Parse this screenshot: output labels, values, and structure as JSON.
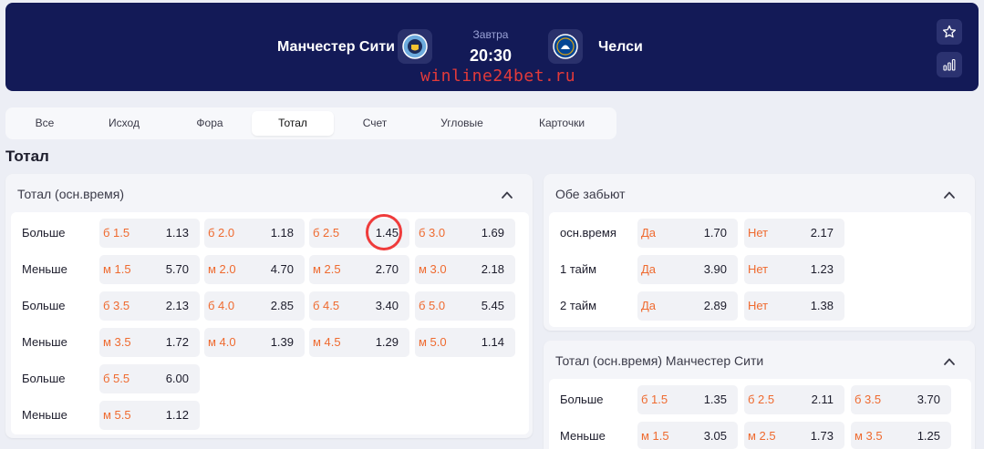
{
  "match": {
    "home_team": "Манчестер Сити",
    "away_team": "Челси",
    "day": "Завтра",
    "time": "20:30",
    "watermark": "winline24bet.ru",
    "home_crest_icon": "man-city-crest-icon",
    "away_crest_icon": "chelsea-crest-icon"
  },
  "tabs": [
    {
      "label": "Все"
    },
    {
      "label": "Исход"
    },
    {
      "label": "Фора"
    },
    {
      "label": "Тотал",
      "active": true
    },
    {
      "label": "Счет"
    },
    {
      "label": "Угловые"
    },
    {
      "label": "Карточки"
    }
  ],
  "section_title": "Тотал",
  "total_panel": {
    "title": "Тотал (осн.время)",
    "rows": [
      {
        "label": "Больше",
        "cells": [
          {
            "k": "б 1.5",
            "o": "1.13"
          },
          {
            "k": "б 2.0",
            "o": "1.18"
          },
          {
            "k": "б 2.5",
            "o": "1.45"
          },
          {
            "k": "б 3.0",
            "o": "1.69"
          }
        ]
      },
      {
        "label": "Меньше",
        "cells": [
          {
            "k": "м 1.5",
            "o": "5.70"
          },
          {
            "k": "м 2.0",
            "o": "4.70"
          },
          {
            "k": "м 2.5",
            "o": "2.70"
          },
          {
            "k": "м 3.0",
            "o": "2.18"
          }
        ]
      },
      {
        "label": "Больше",
        "cells": [
          {
            "k": "б 3.5",
            "o": "2.13"
          },
          {
            "k": "б 4.0",
            "o": "2.85"
          },
          {
            "k": "б 4.5",
            "o": "3.40"
          },
          {
            "k": "б 5.0",
            "o": "5.45"
          }
        ]
      },
      {
        "label": "Меньше",
        "cells": [
          {
            "k": "м 3.5",
            "o": "1.72"
          },
          {
            "k": "м 4.0",
            "o": "1.39"
          },
          {
            "k": "м 4.5",
            "o": "1.29"
          },
          {
            "k": "м 5.0",
            "o": "1.14"
          }
        ]
      },
      {
        "label": "Больше",
        "cells": [
          {
            "k": "б 5.5",
            "o": "6.00"
          }
        ]
      },
      {
        "label": "Меньше",
        "cells": [
          {
            "k": "м 5.5",
            "o": "1.12"
          }
        ]
      }
    ]
  },
  "btts_panel": {
    "title": "Обе забьют",
    "rows": [
      {
        "label": "осн.время",
        "cells": [
          {
            "k": "Да",
            "o": "1.70"
          },
          {
            "k": "Нет",
            "o": "2.17"
          }
        ]
      },
      {
        "label": "1 тайм",
        "cells": [
          {
            "k": "Да",
            "o": "3.90"
          },
          {
            "k": "Нет",
            "o": "1.23"
          }
        ]
      },
      {
        "label": "2 тайм",
        "cells": [
          {
            "k": "Да",
            "o": "2.89"
          },
          {
            "k": "Нет",
            "o": "1.38"
          }
        ]
      }
    ]
  },
  "home_total_panel": {
    "title": "Тотал (осн.время) Манчестер Сити",
    "rows": [
      {
        "label": "Больше",
        "cells": [
          {
            "k": "б 1.5",
            "o": "1.35"
          },
          {
            "k": "б 2.5",
            "o": "2.11"
          },
          {
            "k": "б 3.5",
            "o": "3.70"
          }
        ]
      },
      {
        "label": "Меньше",
        "cells": [
          {
            "k": "м 1.5",
            "o": "3.05"
          },
          {
            "k": "м 2.5",
            "o": "1.73"
          },
          {
            "k": "м 3.5",
            "o": "1.25"
          }
        ]
      }
    ]
  },
  "colors": {
    "header_bg": "#131a57",
    "accent_orange": "#ef6a2f",
    "highlight_circle": "#ef3b3b"
  }
}
